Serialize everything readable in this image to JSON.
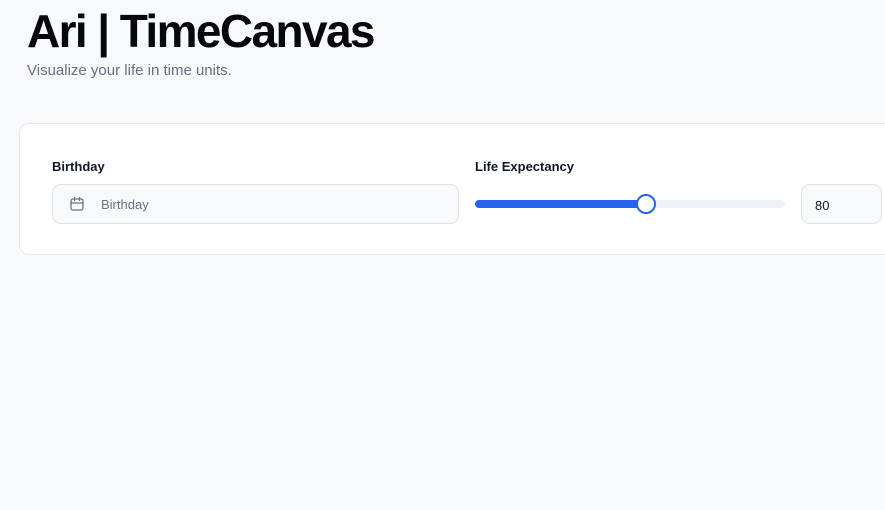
{
  "header": {
    "title": "Ari | TimeCanvas",
    "subtitle": "Visualize your life in time units."
  },
  "form": {
    "birthday": {
      "label": "Birthday",
      "placeholder": "Birthday",
      "value": "",
      "icon": "calendar-icon"
    },
    "life_expectancy": {
      "label": "Life Expectancy",
      "value": "80",
      "slider_fraction": 0.55
    }
  },
  "colors": {
    "accent": "#2563eb",
    "background": "#f8f9fb",
    "card": "#ffffff",
    "muted_text": "#667085"
  }
}
